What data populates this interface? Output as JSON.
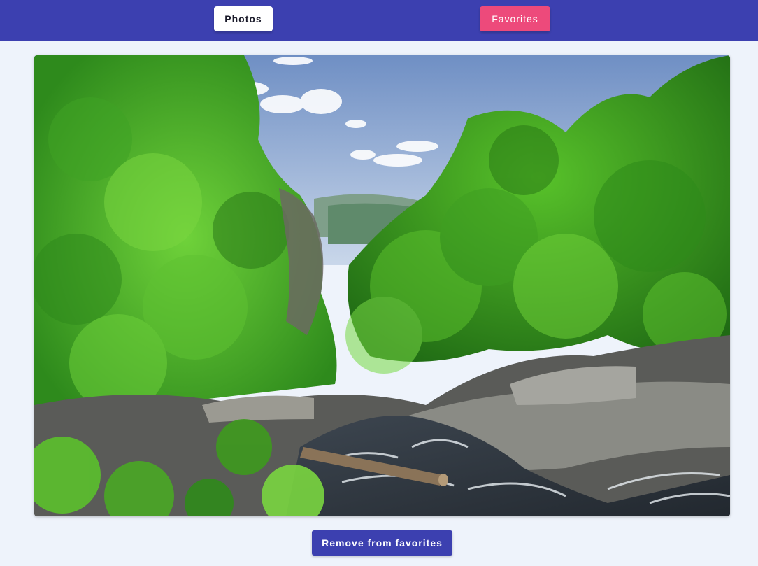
{
  "nav": {
    "photos_label": "Photos",
    "favorites_label": "Favorites"
  },
  "photo": {
    "subject": "forest-waterfall-landscape"
  },
  "actions": {
    "remove_label": "Remove from favorites"
  },
  "colors": {
    "topbar": "#3c40b0",
    "favorites_accent": "#ed4a7b",
    "page_background": "#eef3fb"
  }
}
